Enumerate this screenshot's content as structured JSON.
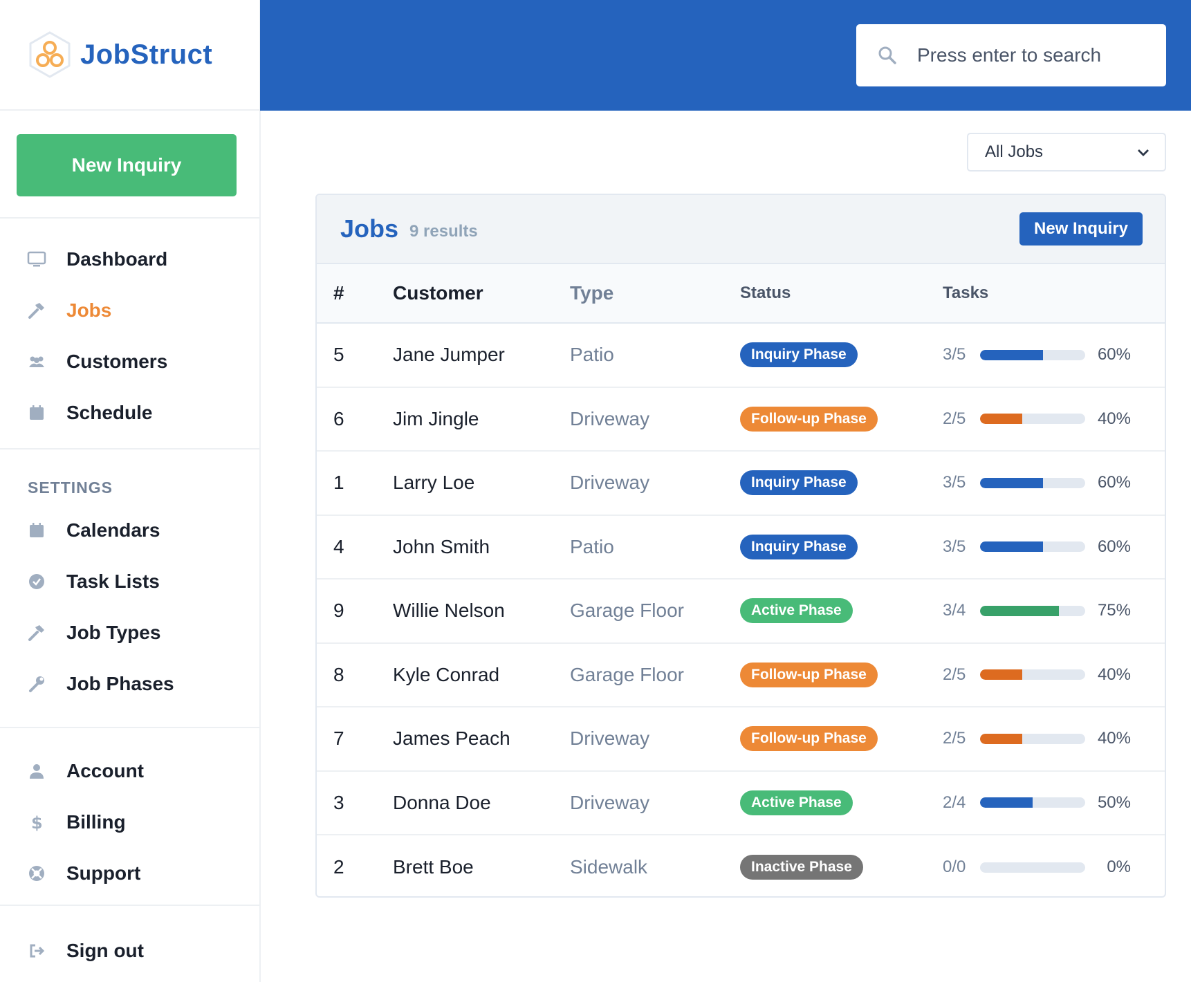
{
  "brand": {
    "name": "JobStruct"
  },
  "sidebar": {
    "new_inquiry": "New Inquiry",
    "nav": [
      {
        "label": "Dashboard",
        "icon": "monitor-icon",
        "active": false
      },
      {
        "label": "Jobs",
        "icon": "hammer-icon",
        "active": true
      },
      {
        "label": "Customers",
        "icon": "users-icon",
        "active": false
      },
      {
        "label": "Schedule",
        "icon": "calendar-icon",
        "active": false
      }
    ],
    "settings_title": "SETTINGS",
    "settings": [
      {
        "label": "Calendars",
        "icon": "calendar-icon"
      },
      {
        "label": "Task Lists",
        "icon": "check-circle-icon"
      },
      {
        "label": "Job Types",
        "icon": "hammer-icon"
      },
      {
        "label": "Job Phases",
        "icon": "wrench-icon"
      }
    ],
    "account": [
      {
        "label": "Account",
        "icon": "user-icon"
      },
      {
        "label": "Billing",
        "icon": "dollar-icon"
      },
      {
        "label": "Support",
        "icon": "lifebuoy-icon"
      }
    ],
    "signout": {
      "label": "Sign out",
      "icon": "sign-out-icon"
    }
  },
  "search": {
    "placeholder": "Press enter to search"
  },
  "filter": {
    "selected": "All Jobs"
  },
  "jobs": {
    "title": "Jobs",
    "count": "9 results",
    "new_inquiry": "New Inquiry",
    "columns": [
      "#",
      "Customer",
      "Type",
      "Status",
      "Tasks"
    ],
    "rows": [
      {
        "num": "5",
        "customer": "Jane Jumper",
        "type": "Patio",
        "status": "Inquiry Phase",
        "status_color": "#2563bd",
        "tasks": "3/5",
        "progress": 0.6,
        "pct": "60%",
        "bar_color": "#2563bd"
      },
      {
        "num": "6",
        "customer": "Jim Jingle",
        "type": "Driveway",
        "status": "Follow-up Phase",
        "status_color": "#ed8936",
        "tasks": "2/5",
        "progress": 0.4,
        "pct": "40%",
        "bar_color": "#dd6b20"
      },
      {
        "num": "1",
        "customer": "Larry Loe",
        "type": "Driveway",
        "status": "Inquiry Phase",
        "status_color": "#2563bd",
        "tasks": "3/5",
        "progress": 0.6,
        "pct": "60%",
        "bar_color": "#2563bd"
      },
      {
        "num": "4",
        "customer": "John Smith",
        "type": "Patio",
        "status": "Inquiry Phase",
        "status_color": "#2563bd",
        "tasks": "3/5",
        "progress": 0.6,
        "pct": "60%",
        "bar_color": "#2563bd"
      },
      {
        "num": "9",
        "customer": "Willie Nelson",
        "type": "Garage Floor",
        "status": "Active Phase",
        "status_color": "#48bb78",
        "tasks": "3/4",
        "progress": 0.75,
        "pct": "75%",
        "bar_color": "#38a169"
      },
      {
        "num": "8",
        "customer": "Kyle Conrad",
        "type": "Garage Floor",
        "status": "Follow-up Phase",
        "status_color": "#ed8936",
        "tasks": "2/5",
        "progress": 0.4,
        "pct": "40%",
        "bar_color": "#dd6b20"
      },
      {
        "num": "7",
        "customer": "James Peach",
        "type": "Driveway",
        "status": "Follow-up Phase",
        "status_color": "#ed8936",
        "tasks": "2/5",
        "progress": 0.4,
        "pct": "40%",
        "bar_color": "#dd6b20"
      },
      {
        "num": "3",
        "customer": "Donna Doe",
        "type": "Driveway",
        "status": "Active Phase",
        "status_color": "#48bb78",
        "tasks": "2/4",
        "progress": 0.5,
        "pct": "50%",
        "bar_color": "#2563bd"
      },
      {
        "num": "2",
        "customer": "Brett Boe",
        "type": "Sidewalk",
        "status": "Inactive Phase",
        "status_color": "#757575",
        "tasks": "0/0",
        "progress": 0,
        "pct": "0%",
        "bar_color": "#2563bd"
      }
    ]
  }
}
